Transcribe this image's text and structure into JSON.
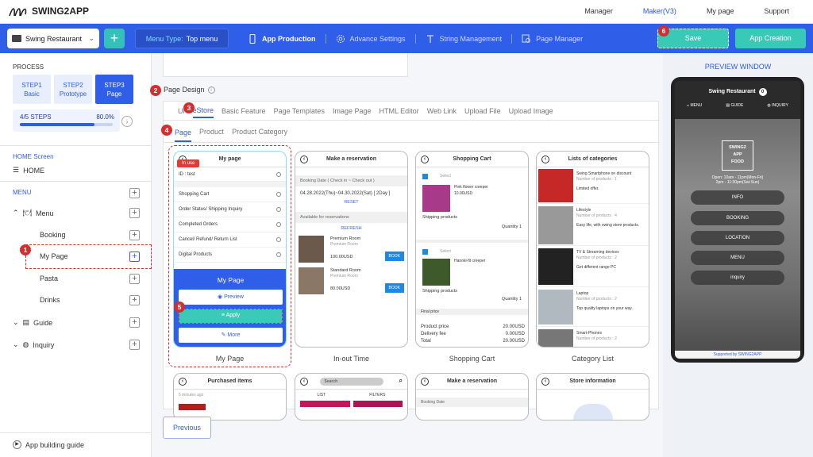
{
  "app": {
    "name": "SWING2APP"
  },
  "topnav": [
    {
      "label": "Manager"
    },
    {
      "label": "Maker(V3)"
    },
    {
      "label": "My page"
    },
    {
      "label": "Support"
    }
  ],
  "toolbar": {
    "app_name": "Swing Restaurant",
    "menu_type_label": "Menu Type:",
    "menu_type_value": "Top menu",
    "tabs": [
      {
        "label": "App Production"
      },
      {
        "label": "Advance Settings"
      },
      {
        "label": "String Management"
      },
      {
        "label": "Page Manager"
      }
    ],
    "save": "Save",
    "app_creation": "App Creation"
  },
  "sidebar": {
    "process": "PROCESS",
    "steps": [
      {
        "num": "STEP1",
        "label": "Basic"
      },
      {
        "num": "STEP2",
        "label": "Prototype"
      },
      {
        "num": "STEP3",
        "label": "Page"
      }
    ],
    "progress_label": "4/5 STEPS",
    "progress_value": "80.0%",
    "progress_fraction": 0.8,
    "home_screen": "HOME Screen",
    "home": "HOME",
    "menu_title": "MENU",
    "menu": "Menu",
    "booking": "Booking",
    "mypage": "My Page",
    "pasta": "Pasta",
    "drinks": "Drinks",
    "guide": "Guide",
    "inquiry": "Inquiry",
    "guide_link": "App building guide"
  },
  "center": {
    "page_design": "Page Design",
    "subtabs": [
      {
        "label": "Ui"
      },
      {
        "label": "eStore"
      },
      {
        "label": "Basic Feature"
      },
      {
        "label": "Page Templates"
      },
      {
        "label": "Image Page"
      },
      {
        "label": "HTML Editor"
      },
      {
        "label": "Web Link"
      },
      {
        "label": "Upload File"
      },
      {
        "label": "Upload Image"
      }
    ],
    "subtabs2": [
      {
        "label": "Page"
      },
      {
        "label": "Product"
      },
      {
        "label": "Product Category"
      }
    ],
    "previous": "Previous"
  },
  "templates": {
    "mypage": {
      "title": "My page",
      "in_use": "In use",
      "id": "ID : test",
      "rows": [
        "Shopping Cart",
        "Order Status/ Shipping Inquiry",
        "Completed Orders",
        "Cancel/ Refund/ Return List",
        "Digital Products"
      ],
      "overlay_title": "My Page",
      "preview": "Preview",
      "apply": "Apply",
      "more": "More",
      "caption": "My Page"
    },
    "reservation": {
      "title": "Make a reservation",
      "booking_date": "Booking Date ( Check in ~ Check out )",
      "dates": "04.28.2022(Thu)~04.30.2022(Sat) [ 2Day ]",
      "reset": "RESET",
      "available": "Available for reservations",
      "refresh": "REFRESH",
      "room1": "Premium Room",
      "room1_sub": "Premium Room",
      "price1": "100.00USD",
      "room2": "Standard Room",
      "room2_sub": "Premium Room",
      "price2": "80.00USD",
      "book": "BOOK",
      "caption": "In-out Time"
    },
    "cart": {
      "title": "Shopping Cart",
      "select": "Select",
      "item1": "Pink flower creeper",
      "item1_price": "10.00USD",
      "shipping": "Shipping products",
      "quantity": "Quantity",
      "qty": "1",
      "item2": "Hanoki-fit creeper",
      "final": "Final price",
      "product_price": "Product price",
      "product_price_val": "20.00USD",
      "delivery": "Delivery fee",
      "delivery_val": "0.00USD",
      "total": "Total",
      "total_val": "20.00USD",
      "caption": "Shopping Cart"
    },
    "categories": {
      "title": "Lists of categories",
      "items": [
        {
          "name": "Swing Smartphone on discount",
          "count": "Number of products : 1",
          "desc": "Limited offer."
        },
        {
          "name": "Lifestyle",
          "count": "Number of products : 4",
          "desc": "Easy life, with swing store products."
        },
        {
          "name": "TV & Streaming devices",
          "count": "Number of products : 2",
          "desc": "Get different range PC"
        },
        {
          "name": "Laptop",
          "count": "Number of products : 2",
          "desc": "Top quality laptops on your way."
        },
        {
          "name": "Smart-Phones",
          "count": "Number of products : 2",
          "desc": ""
        }
      ],
      "caption": "Category List"
    },
    "row2": [
      {
        "title": "Purchased items",
        "sub": "5 minutes ago"
      },
      {
        "title": "",
        "search": "Search",
        "list": "LIST",
        "filters": "FILTERS"
      },
      {
        "title": "Make a reservation",
        "sub": "Booking Date"
      },
      {
        "title": "Store information",
        "sub": ""
      }
    ]
  },
  "preview": {
    "title": "PREVIEW WINDOW",
    "app": "Swing Restaurant",
    "badge": "0",
    "nav": [
      {
        "label": "MENU"
      },
      {
        "label": "GUIDE"
      },
      {
        "label": "INQUIRY"
      }
    ],
    "logo": "SWING2\nAPP\nFOOD",
    "hours1": "Open: 10am - 11pm(Mon-Fri)",
    "hours2": "2pm - 11:30pm(Sat-Sun)",
    "buttons": [
      {
        "label": "INFO"
      },
      {
        "label": "BOOKING"
      },
      {
        "label": "LOCATION"
      },
      {
        "label": "MENU"
      },
      {
        "label": "inquiry"
      }
    ],
    "supported": "Supported by SWING2APP"
  },
  "badges": [
    "1",
    "2",
    "3",
    "4",
    "5",
    "6"
  ]
}
